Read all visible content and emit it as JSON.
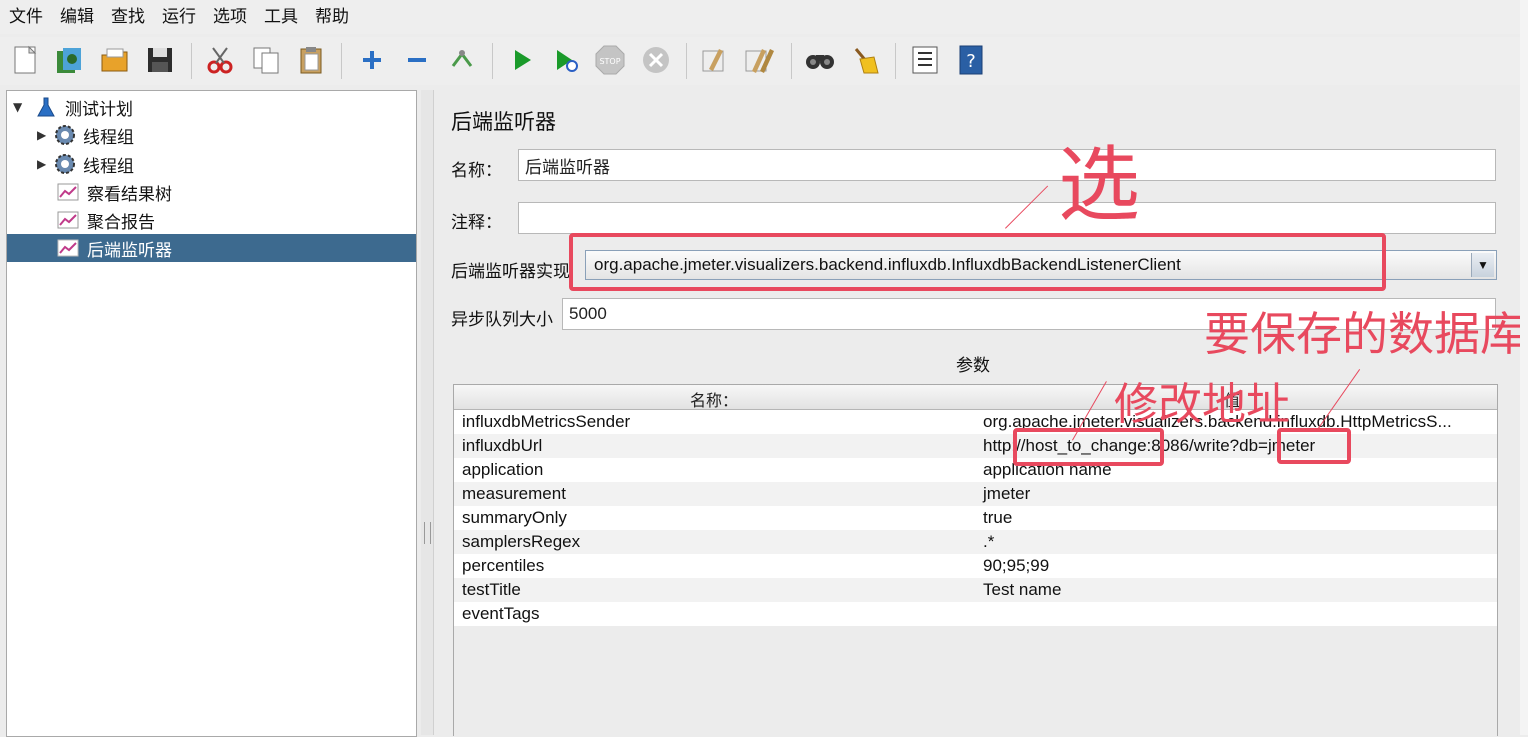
{
  "menubar": {
    "items": [
      "文件",
      "编辑",
      "查找",
      "运行",
      "选项",
      "工具",
      "帮助"
    ]
  },
  "toolbar": {
    "icons": [
      "new-icon",
      "templates-icon",
      "open-icon",
      "save-icon",
      "cut-icon",
      "copy-icon",
      "paste-icon",
      "expand-icon",
      "collapse-icon",
      "toggle-icon",
      "start-icon",
      "start-no-timers-icon",
      "stop-icon",
      "shutdown-icon",
      "clear-icon",
      "clear-all-icon",
      "search-icon",
      "reset-search-icon",
      "function-helper-icon",
      "help-icon"
    ]
  },
  "tree": {
    "items": [
      {
        "label": "测试计划",
        "icon": "test-plan-icon",
        "expanded": true
      },
      {
        "label": "线程组",
        "icon": "gear-icon",
        "expanded": false
      },
      {
        "label": "线程组",
        "icon": "gear-icon",
        "expanded": false
      },
      {
        "label": "察看结果树",
        "icon": "chart-icon"
      },
      {
        "label": "聚合报告",
        "icon": "chart-icon"
      },
      {
        "label": "后端监听器",
        "icon": "chart-icon",
        "selected": true
      }
    ]
  },
  "panel": {
    "title": "后端监听器",
    "name_label": "名称：",
    "name_value": "后端监听器",
    "comment_label": "注释：",
    "comment_value": "",
    "impl_label": "后端监听器实现",
    "impl_value": "org.apache.jmeter.visualizers.backend.influxdb.InfluxdbBackendListenerClient",
    "queue_label": "异步队列大小",
    "queue_value": "5000",
    "params_label": "参数"
  },
  "params_table": {
    "columns": [
      "名称：",
      "值"
    ],
    "rows": [
      {
        "name": "influxdbMetricsSender",
        "value": "org.apache.jmeter.visualizers.backend.influxdb.HttpMetricsS..."
      },
      {
        "name": "influxdbUrl",
        "value": "http://host_to_change:8086/write?db=jmeter"
      },
      {
        "name": "application",
        "value": "application name"
      },
      {
        "name": "measurement",
        "value": "jmeter"
      },
      {
        "name": "summaryOnly",
        "value": "true"
      },
      {
        "name": "samplersRegex",
        "value": ".*"
      },
      {
        "name": "percentiles",
        "value": "90;95;99"
      },
      {
        "name": "testTitle",
        "value": "Test name"
      },
      {
        "name": "eventTags",
        "value": ""
      }
    ]
  },
  "annotations": {
    "select": "选",
    "database": "要保存的数据库",
    "change_address": "修改地址",
    "color": "#e8495e"
  }
}
